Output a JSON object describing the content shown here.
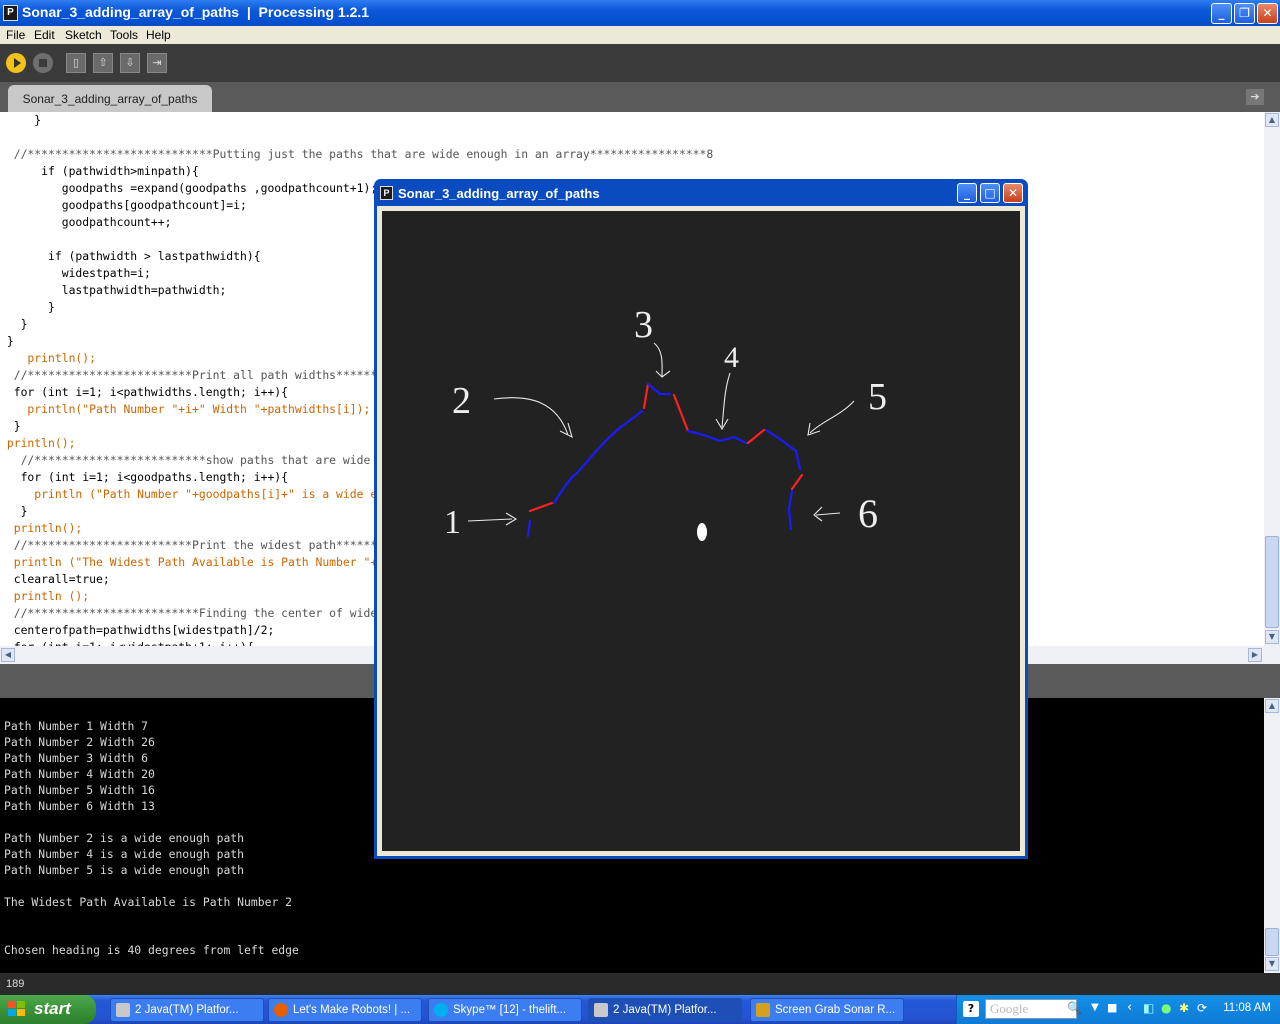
{
  "window": {
    "title": "Sonar_3_adding_array_of_paths  |  Processing 1.2.1",
    "app_icon": "P"
  },
  "menu": [
    "File",
    "Edit",
    "Sketch",
    "Tools",
    "Help"
  ],
  "tab": {
    "label": "Sonar_3_adding_array_of_paths"
  },
  "code_lines": [
    "     }",
    "",
    "  //***************************Putting just the paths that are wide enough in an array*****************8",
    "      if (pathwidth>minpath){",
    "         goodpaths =expand(goodpaths ,goodpathcount+1);",
    "         goodpaths[goodpathcount]=i;",
    "         goodpathcount++;",
    "",
    "       if (pathwidth > lastpathwidth){",
    "         widestpath=i;",
    "         lastpathwidth=pathwidth;",
    "       }",
    "   }",
    " }",
    "    println();",
    "  //************************Print all path widths***************************",
    "  for (int i=1; i<pathwidths.length; i++){",
    "    println(\"Path Number \"+i+\" Width \"+pathwidths[i]);",
    "  }",
    " println();",
    "   //*************************show paths that are wide enough***************************",
    "   for (int i=1; i<goodpaths.length; i++){",
    "     println (\"Path Number \"+goodpaths[i]+\" is a wide enough path\");",
    "   }",
    "  println();",
    "  //************************Print the widest path*****************************",
    "  println (\"The Widest Path Available is Path Number \"+widestpath);",
    "  clearall=true;",
    "  println ();",
    "  //*************************Finding the center of widest path***************************",
    "  centerofpath=pathwidths[widestpath]/2;",
    "  for (int i=1; i<widestpath+1; i++){"
  ],
  "console_lines": [
    "Path Number 1 Width 7",
    "Path Number 2 Width 26",
    "Path Number 3 Width 6",
    "Path Number 4 Width 20",
    "Path Number 5 Width 16",
    "Path Number 6 Width 13",
    "",
    "Path Number 2 is a wide enough path",
    "Path Number 4 is a wide enough path",
    "Path Number 5 is a wide enough path",
    "",
    "The Widest Path Available is Path Number 2",
    "",
    "",
    "Chosen heading is 40 degrees from left edge"
  ],
  "status": {
    "line_number": "189"
  },
  "sketch_window": {
    "title": "Sonar_3_adding_array_of_paths",
    "annotations": [
      "1",
      "2",
      "3",
      "4",
      "5",
      "6"
    ]
  },
  "taskbar": {
    "start_label": "start",
    "tasks": [
      "2 Java(TM) Platfor...",
      "Let's Make Robots! | ...",
      "Skype™ [12] - thelift...",
      "2 Java(TM) Platfor...",
      "Screen Grab Sonar R..."
    ],
    "search_placeholder": "Google",
    "clock": "11:08 AM"
  },
  "colors": {
    "run_button": "#f2c21a",
    "path_blue": "#1a1aff",
    "path_red": "#ff2020"
  }
}
